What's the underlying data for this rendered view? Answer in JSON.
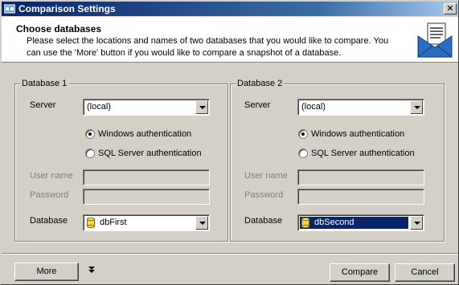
{
  "window": {
    "title": "Comparison Settings"
  },
  "header": {
    "title": "Choose databases",
    "description": "Please select the locations and names of two databases that you would like to compare. You can use the 'More' button if you would like to compare a snapshot of a database.",
    "icon": "envelope-document-icon"
  },
  "database1": {
    "legend": "Database 1",
    "server_label": "Server",
    "server_value": "(local)",
    "auth_windows": "Windows authentication",
    "auth_sql": "SQL Server authentication",
    "auth_selected": "windows",
    "username_label": "User name",
    "password_label": "Password",
    "database_label": "Database",
    "database_value": "dbFirst"
  },
  "database2": {
    "legend": "Database 2",
    "server_label": "Server",
    "server_value": "(local)",
    "auth_windows": "Windows authentication",
    "auth_sql": "SQL Server authentication",
    "auth_selected": "windows",
    "username_label": "User name",
    "password_label": "Password",
    "database_label": "Database",
    "database_value": "dbSecond"
  },
  "footer": {
    "more_label": "More",
    "compare_label": "Compare",
    "cancel_label": "Cancel"
  },
  "colors": {
    "title_bar": "#0a246a",
    "selection": "#0a246a",
    "face": "#d4d0c8"
  }
}
